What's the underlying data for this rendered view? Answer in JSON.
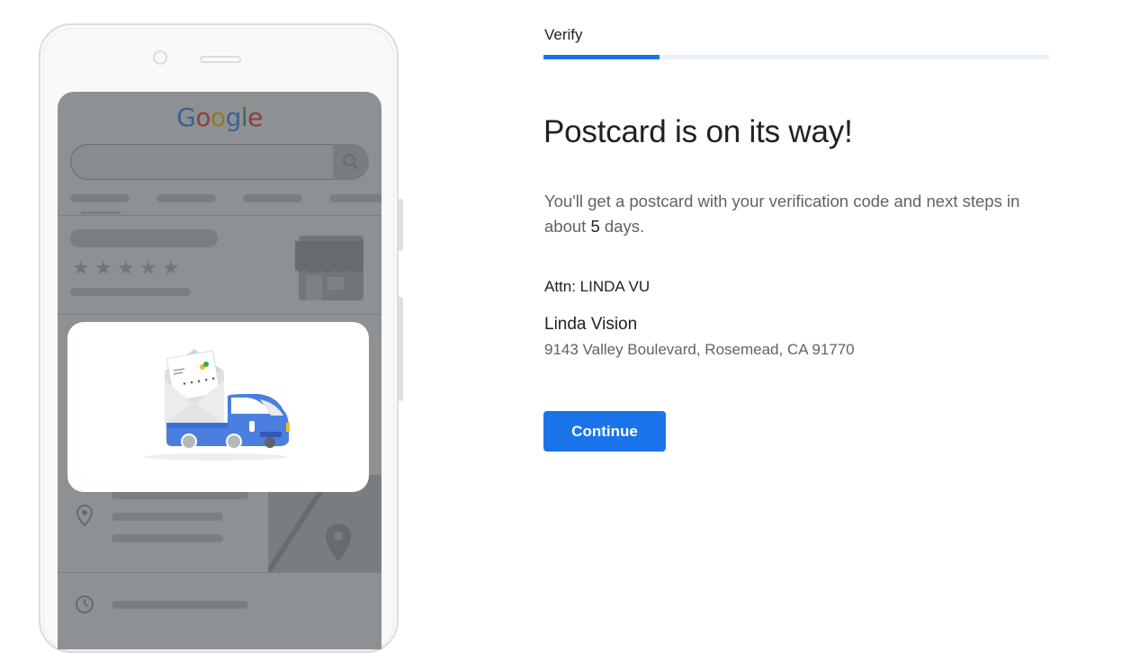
{
  "stepper": {
    "label": "Verify",
    "progress_fraction": 0.23
  },
  "phone_illustration": {
    "logo_text": "Google",
    "logo_colors": [
      "#4285f4",
      "#ea4335",
      "#fbbc05",
      "#4285f4",
      "#34a853",
      "#ea4335"
    ],
    "rating_stars": 5,
    "icons": [
      "search-icon",
      "storefront-icon",
      "location-pin-icon",
      "map-icon",
      "clock-icon",
      "envelope-icon",
      "truck-icon"
    ]
  },
  "main": {
    "headline": "Postcard is on its way!",
    "description_prefix": "You'll get a postcard with your verification code and next steps in about ",
    "description_days": "5",
    "description_suffix": " days.",
    "attn": "Attn: LINDA VU",
    "business_name": "Linda Vision",
    "address": "9143 Valley Boulevard, Rosemead, CA 91770",
    "continue_label": "Continue"
  },
  "colors": {
    "accent": "#1a73e8",
    "progress_track": "#e8f0fe",
    "secondary_text": "#5f6368",
    "primary_text": "#202124"
  }
}
